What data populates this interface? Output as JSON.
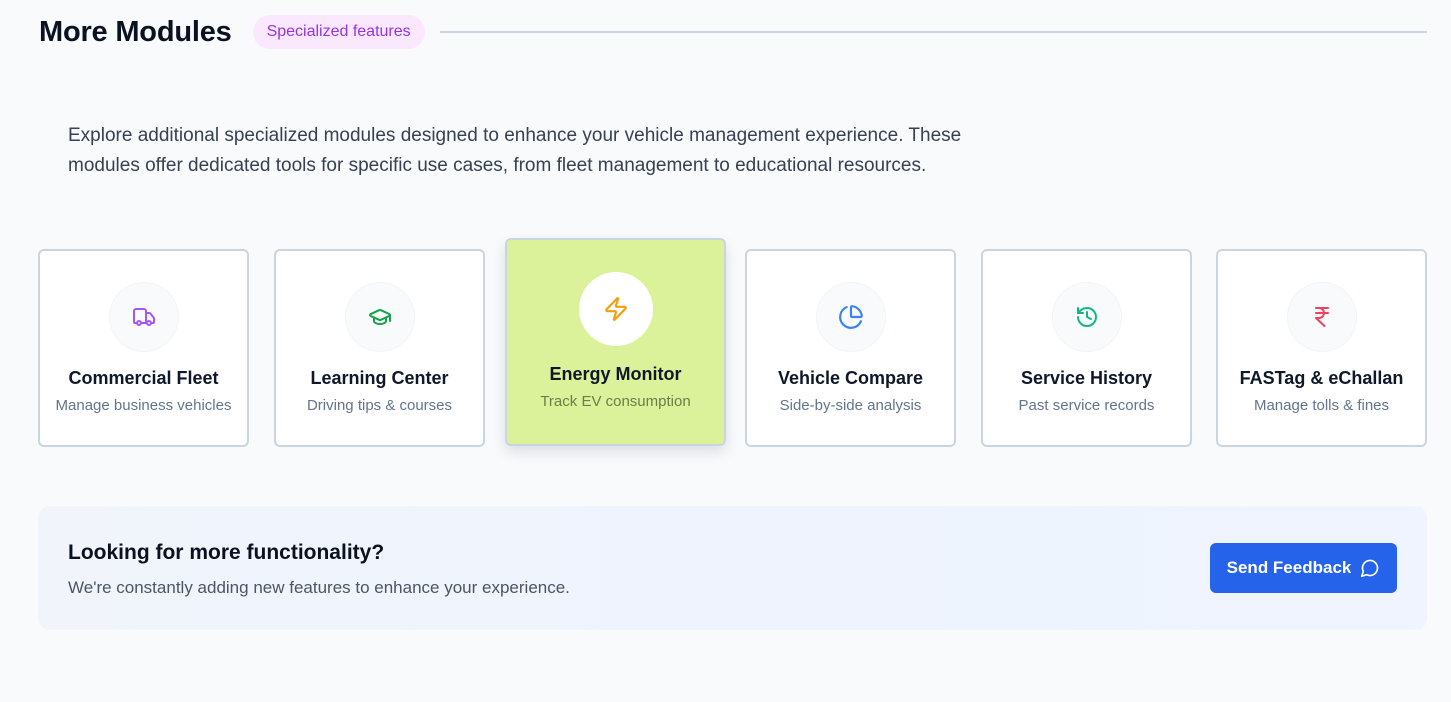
{
  "header": {
    "title": "More Modules",
    "badge": "Specialized features"
  },
  "intro": "Explore additional specialized modules designed to enhance your vehicle management experience. These modules offer dedicated tools for specific use cases, from fleet management to educational resources.",
  "modules": [
    {
      "title": "Commercial Fleet",
      "subtitle": "Manage business vehicles",
      "icon": "truck-icon",
      "color": "#a855f7",
      "active": false
    },
    {
      "title": "Learning Center",
      "subtitle": "Driving tips & courses",
      "icon": "graduation-cap-icon",
      "color": "#16a34a",
      "active": false
    },
    {
      "title": "Energy Monitor",
      "subtitle": "Track EV consumption",
      "icon": "lightning-icon",
      "color": "#f59e0b",
      "active": true
    },
    {
      "title": "Vehicle Compare",
      "subtitle": "Side-by-side analysis",
      "icon": "pie-chart-icon",
      "color": "#3b82f6",
      "active": false
    },
    {
      "title": "Service History",
      "subtitle": "Past service records",
      "icon": "history-icon",
      "color": "#10b981",
      "active": false
    },
    {
      "title": "FASTag & eChallan",
      "subtitle": "Manage tolls & fines",
      "icon": "rupee-icon",
      "color": "#f43f5e",
      "active": false
    }
  ],
  "banner": {
    "title": "Looking for more functionality?",
    "subtitle": "We're constantly adding new features to enhance your experience.",
    "button_label": "Send Feedback",
    "button_icon": "message-circle-icon"
  },
  "colors": {
    "accent": "#2563eb",
    "active_card": "#dcf29a",
    "badge_bg": "#fae8ff",
    "badge_text": "#9333ea"
  }
}
